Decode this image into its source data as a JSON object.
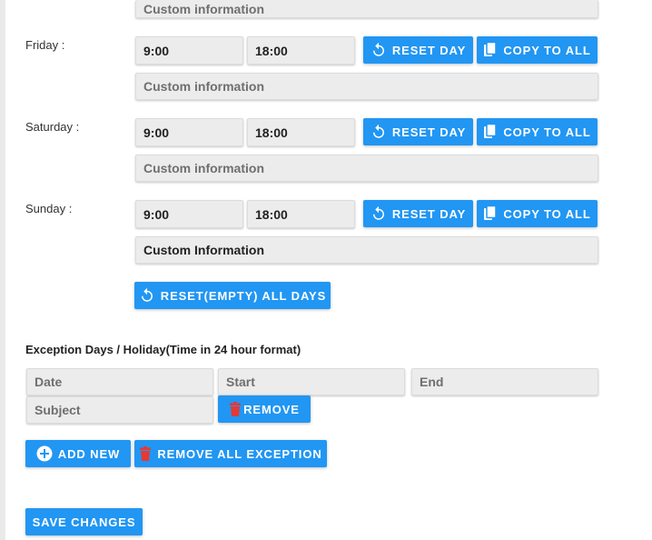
{
  "schedule": {
    "partial_top": {
      "custom_placeholder": "Custom information"
    },
    "days": [
      {
        "label": "Friday :",
        "start": "9:00",
        "end": "18:00",
        "custom": "Custom information",
        "custom_is_placeholder": true
      },
      {
        "label": "Saturday :",
        "start": "9:00",
        "end": "18:00",
        "custom": "Custom information",
        "custom_is_placeholder": true
      },
      {
        "label": "Sunday :",
        "start": "9:00",
        "end": "18:00",
        "custom": "Custom Information",
        "custom_is_placeholder": false
      }
    ],
    "reset_day_label": "RESET DAY",
    "copy_to_all_label": "COPY TO ALL",
    "reset_all_label": "RESET(EMPTY) ALL DAYS"
  },
  "exceptions": {
    "title": "Exception Days / Holiday(Time in 24 hour format)",
    "date_placeholder": "Date",
    "start_placeholder": "Start",
    "end_placeholder": "End",
    "subject_placeholder": "Subject",
    "remove_label": "REMOVE",
    "add_new_label": "ADD NEW",
    "remove_all_label": "REMOVE ALL EXCEPTION"
  },
  "footer": {
    "save_label": "SAVE CHANGES"
  },
  "colors": {
    "primary": "#2196f3",
    "danger_icon": "#e53935",
    "field_bg": "#ececec"
  },
  "icons": {
    "reset": "reset-icon",
    "copy": "copy-icon",
    "trash": "trash-icon",
    "add": "plus-circle-icon"
  }
}
